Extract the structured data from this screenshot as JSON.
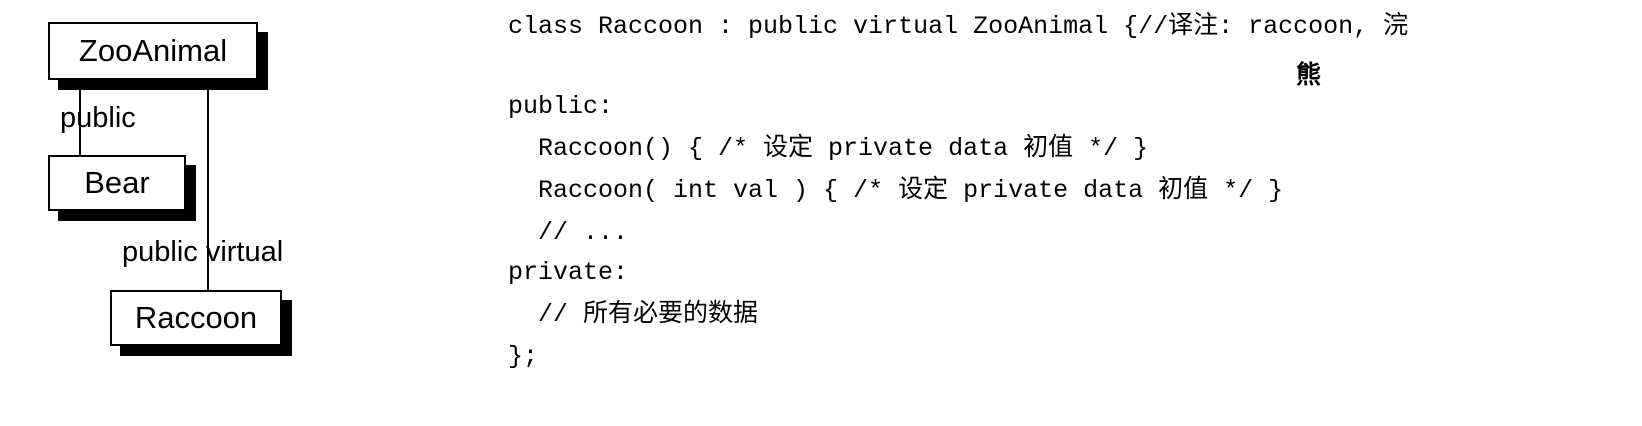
{
  "diagram": {
    "boxes": {
      "zooanimal": "ZooAnimal",
      "bear": "Bear",
      "raccoon": "Raccoon"
    },
    "edge_labels": {
      "zooanimal_bear": "public",
      "zooanimal_raccoon": "public virtual"
    }
  },
  "code": {
    "lines": [
      "class Raccoon : public virtual ZooAnimal {//译注: raccoon, 浣",
      "public:",
      "  Raccoon() { /* 设定 private data 初值 */ }",
      "  Raccoon( int val ) { /* 设定 private data 初值 */ }",
      "  // ...",
      "private:",
      "  // 所有必要的数据",
      "};"
    ],
    "line1_continuation": "熊"
  }
}
